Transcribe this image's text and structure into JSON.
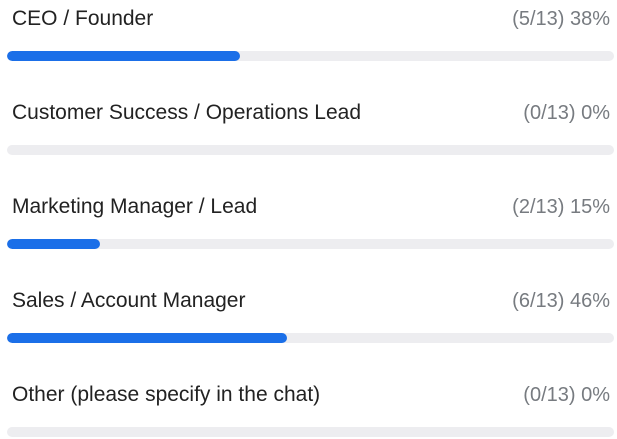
{
  "poll": {
    "options": [
      {
        "label": "CEO / Founder",
        "stat": "(5/13) 38%",
        "votes": 5,
        "total": 13
      },
      {
        "label": "Customer Success / Operations Lead",
        "stat": "(0/13) 0%",
        "votes": 0,
        "total": 13
      },
      {
        "label": "Marketing Manager / Lead",
        "stat": "(2/13) 15%",
        "votes": 2,
        "total": 13
      },
      {
        "label": "Sales / Account Manager",
        "stat": "(6/13) 46%",
        "votes": 6,
        "total": 13
      },
      {
        "label": "Other (please specify in the chat)",
        "stat": "(0/13) 0%",
        "votes": 0,
        "total": 13
      }
    ]
  },
  "colors": {
    "bar_fill": "#1b6fe8",
    "bar_track": "#ededf0",
    "label_text": "#222222",
    "stat_text": "#777b80"
  }
}
